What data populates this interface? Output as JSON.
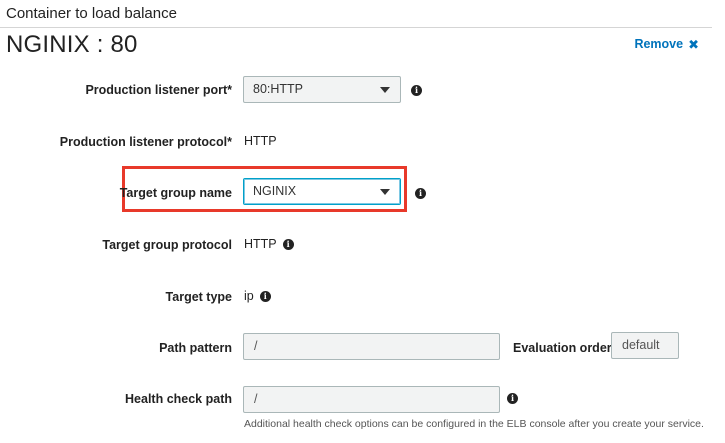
{
  "section": {
    "header": "Container to load balance"
  },
  "container": {
    "title": "NGINIX : 80",
    "remove_label": "Remove",
    "remove_icon": "close-icon"
  },
  "fields": {
    "production_listener_port": {
      "label": "Production listener port*",
      "value": "80:HTTP"
    },
    "production_listener_protocol": {
      "label": "Production listener protocol*",
      "value": "HTTP"
    },
    "target_group_name": {
      "label": "Target group name",
      "value": "NGINIX"
    },
    "target_group_protocol": {
      "label": "Target group protocol",
      "value": "HTTP"
    },
    "target_type": {
      "label": "Target type",
      "value": "ip"
    },
    "path_pattern": {
      "label": "Path pattern",
      "value": "/"
    },
    "evaluation_order": {
      "label": "Evaluation order",
      "value": "default"
    },
    "health_check_path": {
      "label": "Health check path",
      "value": "/",
      "helper": "Additional health check options can be configured in the ELB console after you create your service."
    }
  },
  "colors": {
    "link": "#0073bb",
    "highlight": "#e8392a",
    "input_bg": "#f2f3f3",
    "input_border": "#aab7b8",
    "focus_border": "#00a1c9"
  },
  "icons": {
    "info": "info-icon",
    "dropdown": "caret-down-icon"
  }
}
